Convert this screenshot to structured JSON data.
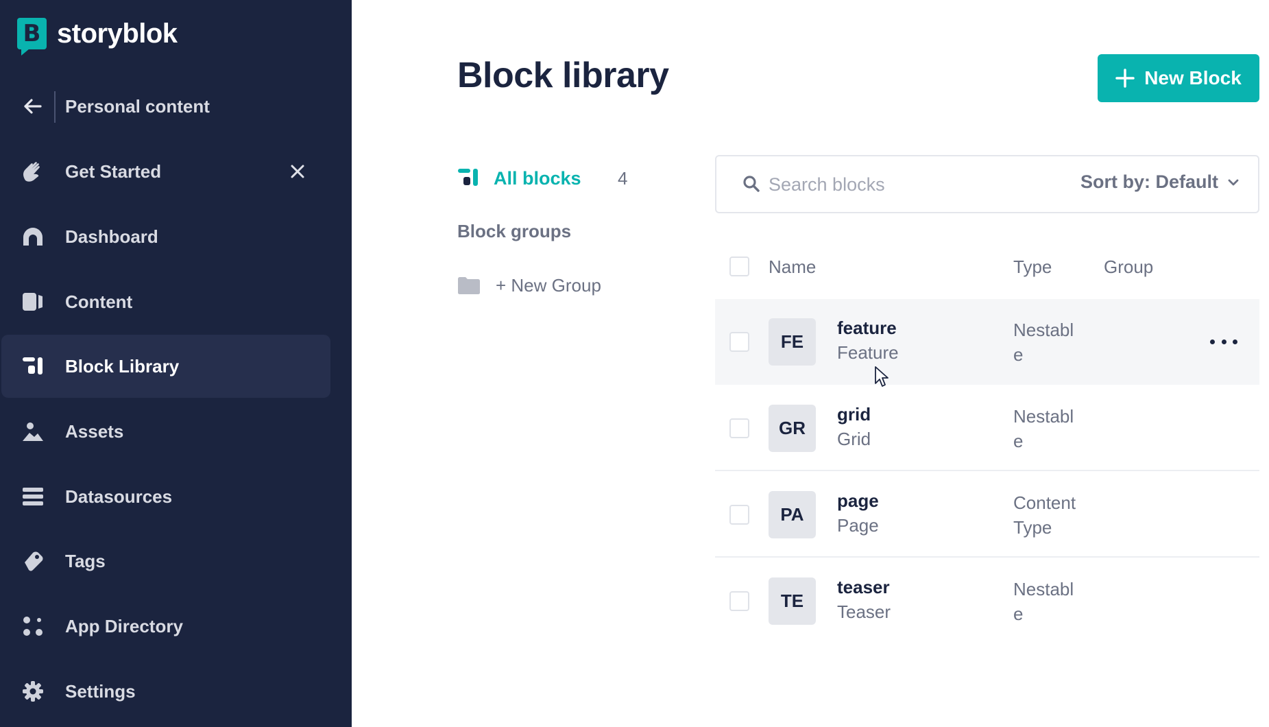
{
  "brand": {
    "name": "storyblok",
    "mark": "B",
    "logo_icon": "storyblok-logo-icon"
  },
  "sidebar": {
    "back": {
      "label": "Personal content",
      "icon": "arrow-left-icon"
    },
    "items": [
      {
        "label": "Get Started",
        "icon": "waving-hand-icon",
        "closable": true
      },
      {
        "label": "Dashboard",
        "icon": "gauge-icon"
      },
      {
        "label": "Content",
        "icon": "content-icon"
      },
      {
        "label": "Block Library",
        "icon": "block-library-icon",
        "active": true
      },
      {
        "label": "Assets",
        "icon": "image-icon"
      },
      {
        "label": "Datasources",
        "icon": "stack-icon"
      },
      {
        "label": "Tags",
        "icon": "tag-icon"
      },
      {
        "label": "App Directory",
        "icon": "grid-dots-icon"
      },
      {
        "label": "Settings",
        "icon": "gear-icon"
      }
    ]
  },
  "main": {
    "title": "Block library",
    "new_block_label": "New Block",
    "filters": {
      "all_blocks_label": "All blocks",
      "all_blocks_count": "4",
      "block_groups_title": "Block groups",
      "new_group_label": "+ New Group"
    },
    "search": {
      "placeholder": "Search blocks",
      "value": ""
    },
    "sort_label": "Sort by: Default",
    "table": {
      "columns": {
        "name": "Name",
        "type": "Type",
        "group": "Group"
      },
      "rows": [
        {
          "badge": "FE",
          "name": "feature",
          "display": "Feature",
          "type": "Nestable",
          "group": ""
        },
        {
          "badge": "GR",
          "name": "grid",
          "display": "Grid",
          "type": "Nestable",
          "group": ""
        },
        {
          "badge": "PA",
          "name": "page",
          "display": "Page",
          "type": "Content Type",
          "group": ""
        },
        {
          "badge": "TE",
          "name": "teaser",
          "display": "Teaser",
          "type": "Nestable",
          "group": ""
        }
      ]
    }
  },
  "colors": {
    "sidebar_bg": "#1b243f",
    "accent": "#09b3af",
    "active_item_bg": "#262f4d"
  }
}
